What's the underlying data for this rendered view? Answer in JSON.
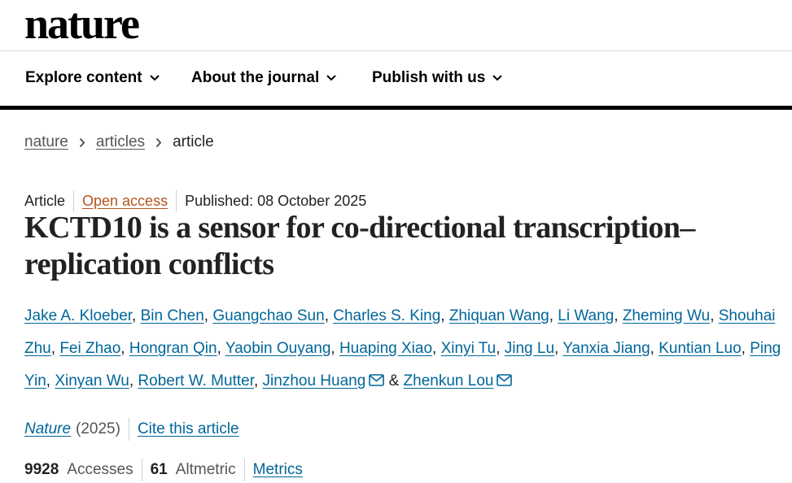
{
  "brand": {
    "logo_text": "nature"
  },
  "nav": {
    "items": [
      {
        "label": "Explore content"
      },
      {
        "label": "About the journal"
      },
      {
        "label": "Publish with us"
      }
    ]
  },
  "breadcrumb": {
    "items": [
      "nature",
      "articles"
    ],
    "current": "article"
  },
  "article": {
    "type": "Article",
    "access": "Open access",
    "published": "Published: 08 October 2025",
    "title": "KCTD10 is a sensor for co-directional transcription–replication conflicts",
    "authors": [
      "Jake A. Kloeber",
      "Bin Chen",
      "Guangchao Sun",
      "Charles S. King",
      "Zhiquan Wang",
      "Li Wang",
      "Zheming Wu",
      "Shouhai Zhu",
      "Fei Zhao",
      "Hongran Qin",
      "Yaobin Ouyang",
      "Huaping Xiao",
      "Xinyi Tu",
      "Jing Lu",
      "Yanxia Jiang",
      "Kuntian Luo",
      "Ping Yin",
      "Xinyan Wu",
      "Robert W. Mutter",
      "Jinzhou Huang",
      "Zhenkun Lou"
    ],
    "author_sep": ",",
    "author_and": "&",
    "journal": "Nature",
    "year": "(2025)",
    "cite_label": "Cite this article"
  },
  "metrics": {
    "accesses_count": "9928",
    "accesses_label": "Accesses",
    "altmetric_count": "61",
    "altmetric_label": "Altmetric",
    "metrics_link": "Metrics"
  },
  "colors": {
    "link": "#006699",
    "open_access": "#b3541e",
    "nav_bar": "#000000"
  },
  "icons": {
    "nav_chevron": "chevron-down-icon",
    "breadcrumb_separator": "chevron-right-icon",
    "email": "mail-icon"
  }
}
